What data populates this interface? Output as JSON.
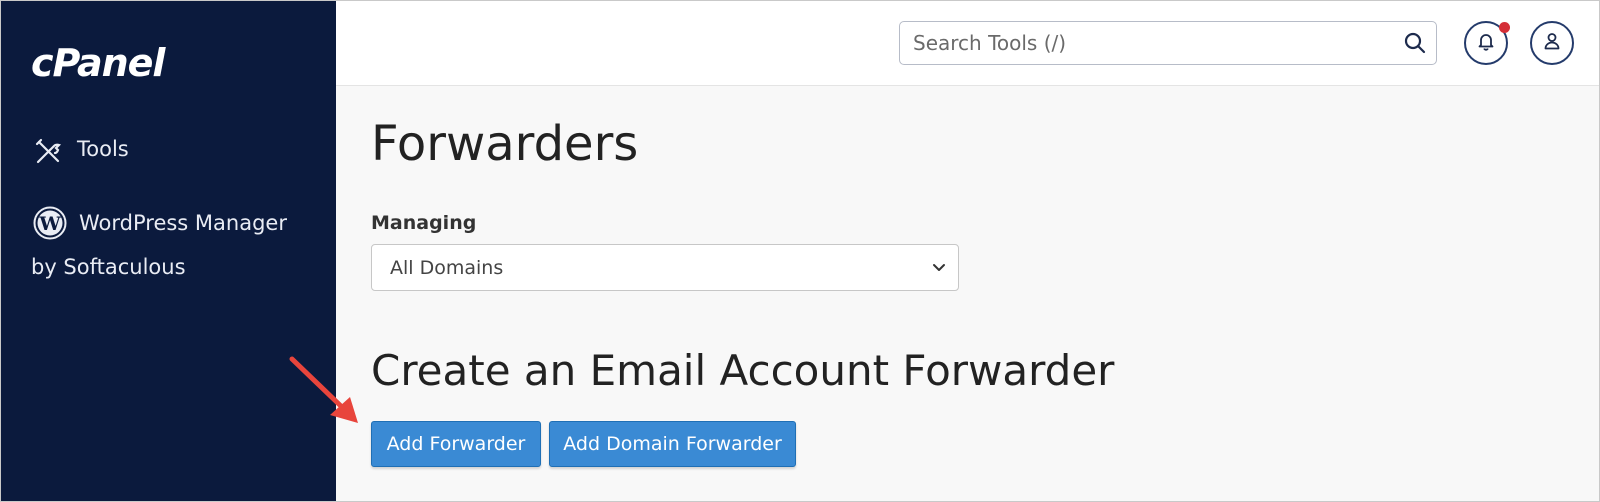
{
  "sidebar": {
    "logo": "cPanel",
    "items": [
      {
        "label": "Tools",
        "icon": "tools-icon"
      },
      {
        "label_line1": "WordPress Manager",
        "label_line2": "by Softaculous",
        "icon": "wordpress-icon"
      }
    ]
  },
  "header": {
    "search_placeholder": "Search Tools (/)",
    "icons": [
      "search-icon",
      "bell-icon",
      "user-icon"
    ]
  },
  "main": {
    "title": "Forwarders",
    "managing_label": "Managing",
    "managing_selected": "All Domains",
    "section_title": "Create an Email Account Forwarder",
    "buttons": {
      "add_forwarder": "Add Forwarder",
      "add_domain_forwarder": "Add Domain Forwarder"
    }
  },
  "colors": {
    "sidebar_bg": "#0b1a3d",
    "button_bg": "#3a8ad4",
    "notification_dot": "#d42e37",
    "annotation_arrow": "#e8453c"
  }
}
